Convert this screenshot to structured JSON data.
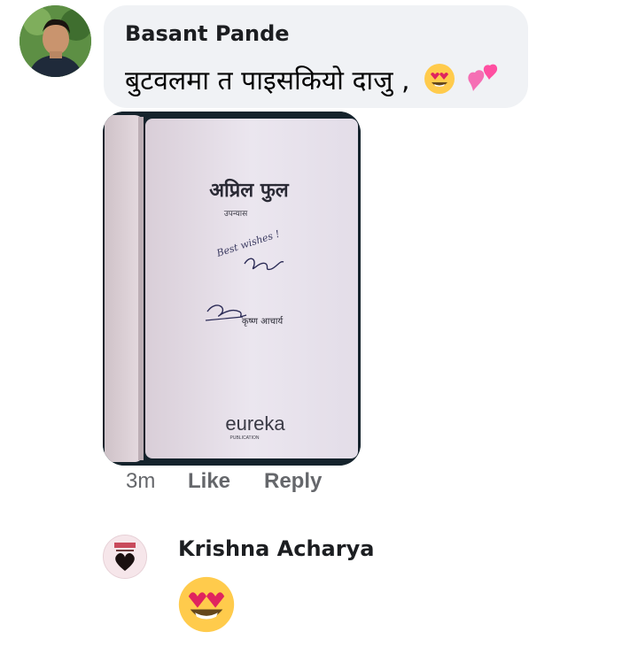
{
  "comment1": {
    "author": "Basant Pande",
    "text": "बुटवलमा त पाइसकियो दाजु ,",
    "emojis": [
      "heart-eyes-emoji",
      "two-hearts-emoji"
    ],
    "photo": {
      "book_title": "अप्रिल फुल",
      "book_subtitle": "उपन्यास",
      "handwritten_note": "Best wishes !",
      "author_line": "कृष्ण आचार्य",
      "publisher": "eureka",
      "publisher_sub": "PUBLICATION"
    },
    "time": "3m",
    "like_label": "Like",
    "reply_label": "Reply"
  },
  "comment2": {
    "author": "Krishna Acharya",
    "emoji": "heart-eyes-emoji"
  },
  "colors": {
    "bubble": "#f0f2f5",
    "meta": "#65676b",
    "name": "#1c1e21"
  }
}
